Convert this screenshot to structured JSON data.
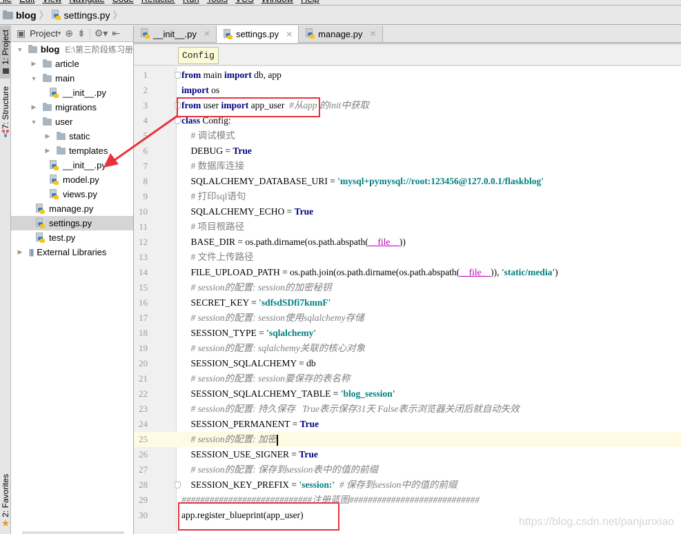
{
  "menu": [
    "File",
    "Edit",
    "View",
    "Navigate",
    "Code",
    "Refactor",
    "Run",
    "Tools",
    "VCS",
    "Window",
    "Help"
  ],
  "breadcrumb": {
    "project": "blog",
    "file": "settings.py"
  },
  "toolstrip": {
    "project_tab": "1: Project",
    "structure_tab": "7: Structure",
    "favorites_tab": "2: Favorites"
  },
  "project_panel": {
    "title": "Project",
    "tree": [
      {
        "name": "blog",
        "type": "folder",
        "depth": 0,
        "expanded": true,
        "path": "E:\\第三阶段练习册"
      },
      {
        "name": "article",
        "type": "folder",
        "depth": 1,
        "expanded": false
      },
      {
        "name": "main",
        "type": "folder",
        "depth": 1,
        "expanded": true
      },
      {
        "name": "__init__.py",
        "type": "py",
        "depth": 2
      },
      {
        "name": "migrations",
        "type": "folder",
        "depth": 1,
        "expanded": false
      },
      {
        "name": "user",
        "type": "folder",
        "depth": 1,
        "expanded": true
      },
      {
        "name": "static",
        "type": "folder",
        "depth": 2,
        "expanded": false
      },
      {
        "name": "templates",
        "type": "folder",
        "depth": 2,
        "expanded": false
      },
      {
        "name": "__init__.py",
        "type": "py",
        "depth": 2
      },
      {
        "name": "model.py",
        "type": "py",
        "depth": 2
      },
      {
        "name": "views.py",
        "type": "py",
        "depth": 2
      },
      {
        "name": "manage.py",
        "type": "py",
        "depth": 1
      },
      {
        "name": "settings.py",
        "type": "py",
        "depth": 1,
        "selected": true
      },
      {
        "name": "test.py",
        "type": "py",
        "depth": 1
      },
      {
        "name": "External Libraries",
        "type": "lib",
        "depth": 0,
        "expanded": false
      }
    ]
  },
  "tabs": [
    {
      "label": "__init__.py",
      "active": false
    },
    {
      "label": "settings.py",
      "active": true
    },
    {
      "label": "manage.py",
      "active": false
    }
  ],
  "tooltip": "Config",
  "editor": {
    "current_line": 25,
    "lines": [
      [
        [
          "kw",
          "from"
        ],
        [
          "t",
          " main "
        ],
        [
          "kw",
          "import"
        ],
        [
          "t",
          " db, app"
        ]
      ],
      [
        [
          "kw",
          "import"
        ],
        [
          "t",
          " os"
        ]
      ],
      [
        [
          "kw",
          "from"
        ],
        [
          "t",
          " user "
        ],
        [
          "kw",
          "import"
        ],
        [
          "t",
          " app_user  "
        ],
        [
          "cm",
          "#从app 的init中获取"
        ]
      ],
      [
        [
          "kw",
          "class"
        ],
        [
          "t",
          " Config:"
        ]
      ],
      [
        [
          "t",
          "    "
        ],
        [
          "cmn",
          "# 调试模式"
        ]
      ],
      [
        [
          "t",
          "    DEBUG = "
        ],
        [
          "kw",
          "True"
        ]
      ],
      [
        [
          "t",
          "    "
        ],
        [
          "cmn",
          "# 数据库连接"
        ]
      ],
      [
        [
          "t",
          "    SQLALCHEMY_DATABASE_URI = "
        ],
        [
          "str",
          "'mysql+pymysql://root:123456@127.0.0.1/flaskblog'"
        ]
      ],
      [
        [
          "t",
          "    "
        ],
        [
          "cmn",
          "# 打印sql语句"
        ]
      ],
      [
        [
          "t",
          "    SQLALCHEMY_ECHO = "
        ],
        [
          "kw",
          "True"
        ]
      ],
      [
        [
          "t",
          "    "
        ],
        [
          "cmn",
          "# 项目根路径"
        ]
      ],
      [
        [
          "t",
          "    BASE_DIR = os.path.dirname(os.path.abspath("
        ],
        [
          "magic",
          "__file__"
        ],
        [
          "t",
          "))"
        ]
      ],
      [
        [
          "t",
          "    "
        ],
        [
          "cmn",
          "# 文件上传路径"
        ]
      ],
      [
        [
          "t",
          "    FILE_UPLOAD_PATH = os.path.join(os.path.dirname(os.path.abspath("
        ],
        [
          "magic",
          "__file__"
        ],
        [
          "t",
          ")), "
        ],
        [
          "str",
          "'static/media'"
        ],
        [
          "t",
          ")"
        ]
      ],
      [
        [
          "t",
          "    "
        ],
        [
          "cm",
          "# session的配置: session的加密秘钥"
        ]
      ],
      [
        [
          "t",
          "    SECRET_KEY = "
        ],
        [
          "str",
          "'sdfsdSDfi7kmnF'"
        ]
      ],
      [
        [
          "t",
          "    "
        ],
        [
          "cm",
          "# session的配置: session使用sqlalchemy存储"
        ]
      ],
      [
        [
          "t",
          "    SESSION_TYPE = "
        ],
        [
          "str",
          "'sqlalchemy'"
        ]
      ],
      [
        [
          "t",
          "    "
        ],
        [
          "cm",
          "# session的配置: sqlalchemy关联的核心对象"
        ]
      ],
      [
        [
          "t",
          "    SESSION_SQLALCHEMY = db"
        ]
      ],
      [
        [
          "t",
          "    "
        ],
        [
          "cm",
          "# session的配置: session要保存的表名称"
        ]
      ],
      [
        [
          "t",
          "    SESSION_SQLALCHEMY_TABLE = "
        ],
        [
          "str",
          "'blog_session'"
        ]
      ],
      [
        [
          "t",
          "    "
        ],
        [
          "cm",
          "# session的配置: 持久保存   True表示保存31天 False表示浏览器关闭后就自动失效"
        ]
      ],
      [
        [
          "t",
          "    SESSION_PERMANENT = "
        ],
        [
          "kw",
          "True"
        ]
      ],
      [
        [
          "t",
          "    "
        ],
        [
          "cm",
          "# session的配置: 加密"
        ]
      ],
      [
        [
          "t",
          "    SESSION_USE_SIGNER = "
        ],
        [
          "kw",
          "True"
        ]
      ],
      [
        [
          "t",
          "    "
        ],
        [
          "cm",
          "# session的配置: 保存到session表中的值的前缀"
        ]
      ],
      [
        [
          "t",
          "    SESSION_KEY_PREFIX = "
        ],
        [
          "str",
          "'session:'"
        ],
        [
          "t",
          "  "
        ],
        [
          "cm",
          "# 保存到session中的值的前缀"
        ]
      ],
      [
        [
          "cm",
          "############################注册蓝图############################"
        ]
      ],
      [
        [
          "t",
          "app.register_blueprint(app_user)"
        ]
      ]
    ]
  },
  "watermark": "https://blog.csdn.net/panjunxiao",
  "colors": {
    "keyword": "#000080",
    "string": "#008080",
    "comment": "#808080",
    "annotation_red": "#e8313a",
    "current_line": "#fffae3"
  }
}
